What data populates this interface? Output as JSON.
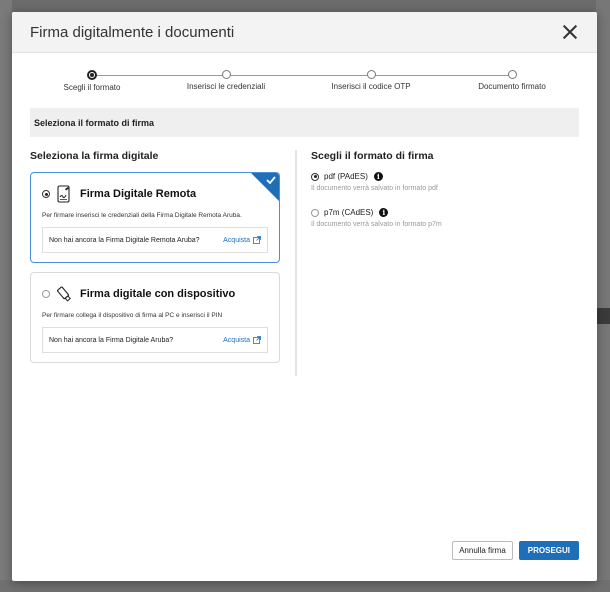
{
  "modal": {
    "title": "Firma digitalmente i documenti"
  },
  "stepper": {
    "steps": [
      {
        "label": "Scegli il formato",
        "active": true
      },
      {
        "label": "Inserisci le credenziali",
        "active": false
      },
      {
        "label": "Inserisci il codice OTP",
        "active": false
      },
      {
        "label": "Documento firmato",
        "active": false
      }
    ]
  },
  "section": {
    "title": "Seleziona il formato di firma"
  },
  "signatures": {
    "title": "Seleziona la firma digitale",
    "options": [
      {
        "title": "Firma Digitale Remota",
        "icon": "remote-signature-icon",
        "selected": true,
        "description": "Per firmare inserisci le credenziali della Firma Digitale Remota Aruba.",
        "promo_text": "Non hai ancora la Firma Digitale Remota Aruba?",
        "promo_link": "Acquista"
      },
      {
        "title": "Firma digitale con dispositivo",
        "icon": "usb-device-icon",
        "selected": false,
        "description": "Per firmare collega il dispositivo di firma al PC e inserisci il PIN",
        "promo_text": "Non hai ancora la Firma Digitale Aruba?",
        "promo_link": "Acquista"
      }
    ]
  },
  "formats": {
    "title": "Scegli il formato di firma",
    "options": [
      {
        "label": "pdf (PAdES)",
        "note": "Il documento verrà salvato in formato pdf",
        "selected": true
      },
      {
        "label": "p7m (CAdES)",
        "note": "Il documento verrà salvato in formato p7m",
        "selected": false
      }
    ]
  },
  "footer": {
    "cancel_label": "Annulla firma",
    "continue_label": "PROSEGUI"
  },
  "colors": {
    "accent": "#1f6fb8"
  }
}
